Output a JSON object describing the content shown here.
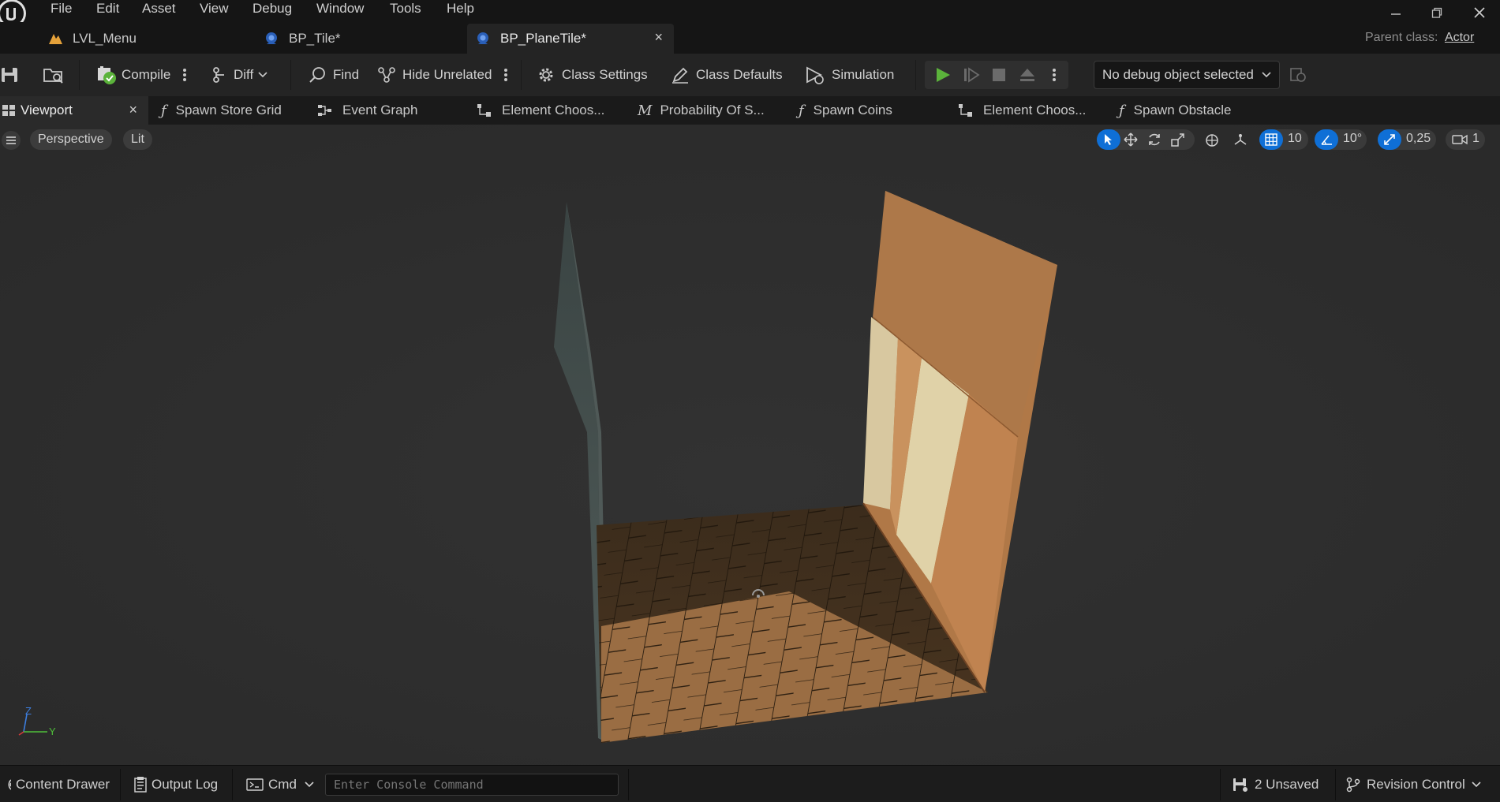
{
  "menu": {
    "items": [
      "File",
      "Edit",
      "Asset",
      "View",
      "Debug",
      "Window",
      "Tools",
      "Help"
    ]
  },
  "doc_tabs": [
    {
      "label": "LVL_Menu",
      "icon": "level-icon"
    },
    {
      "label": "BP_Tile*",
      "icon": "blueprint-icon"
    },
    {
      "label": "BP_PlaneTile*",
      "icon": "blueprint-icon",
      "close": "×"
    }
  ],
  "parent_class": {
    "label": "Parent class:",
    "value": "Actor"
  },
  "toolbar": {
    "compile": "Compile",
    "diff": "Diff",
    "find": "Find",
    "hide_unrelated": "Hide Unrelated",
    "class_settings": "Class Settings",
    "class_defaults": "Class Defaults",
    "simulation": "Simulation",
    "debug_object": "No debug object selected"
  },
  "graph_tabs": [
    {
      "label": "Viewport",
      "icon": "viewport-icon",
      "close": "×"
    },
    {
      "label": "Spawn Store Grid",
      "icon": "function-icon"
    },
    {
      "label": "Event Graph",
      "icon": "event-graph-icon"
    },
    {
      "label": "Element Choos...",
      "icon": "macro-icon"
    },
    {
      "label": "Probability Of S...",
      "icon": "macro-m-icon"
    },
    {
      "label": "Spawn Coins",
      "icon": "function-icon"
    },
    {
      "label": "Element Choos...",
      "icon": "macro-icon"
    },
    {
      "label": "Spawn Obstacle",
      "icon": "function-icon"
    }
  ],
  "viewport": {
    "perspective": "Perspective",
    "lit": "Lit",
    "grid_snap": "10",
    "rotation_snap": "10°",
    "scale_snap": "0,25",
    "camera_speed": "1",
    "axis_z": "Z",
    "axis_y": "Y"
  },
  "statusbar": {
    "content_drawer": "Content Drawer",
    "output_log": "Output Log",
    "cmd": "Cmd",
    "console_placeholder": "Enter Console Command",
    "unsaved": "2 Unsaved",
    "revision_control": "Revision Control"
  },
  "colors": {
    "accent_blue": "#0f6fd6",
    "play_green": "#5bb33b"
  }
}
